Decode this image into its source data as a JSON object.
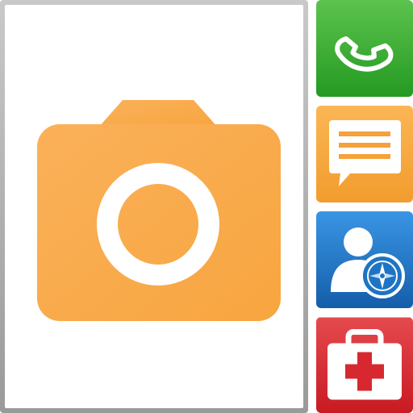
{
  "main_preview": {
    "icon": "camera-icon",
    "accent_color": "#f8a94a",
    "frame_color": "#a9a9a9"
  },
  "tiles": [
    {
      "id": "phone",
      "icon": "phone-handset-icon",
      "color": "#34a52c"
    },
    {
      "id": "message",
      "icon": "chat-bubble-icon",
      "color": "#f6a13a"
    },
    {
      "id": "contacts",
      "icon": "user-compass-icon",
      "color": "#1e74c4"
    },
    {
      "id": "medical",
      "icon": "first-aid-kit-icon",
      "color": "#d7282f"
    }
  ]
}
